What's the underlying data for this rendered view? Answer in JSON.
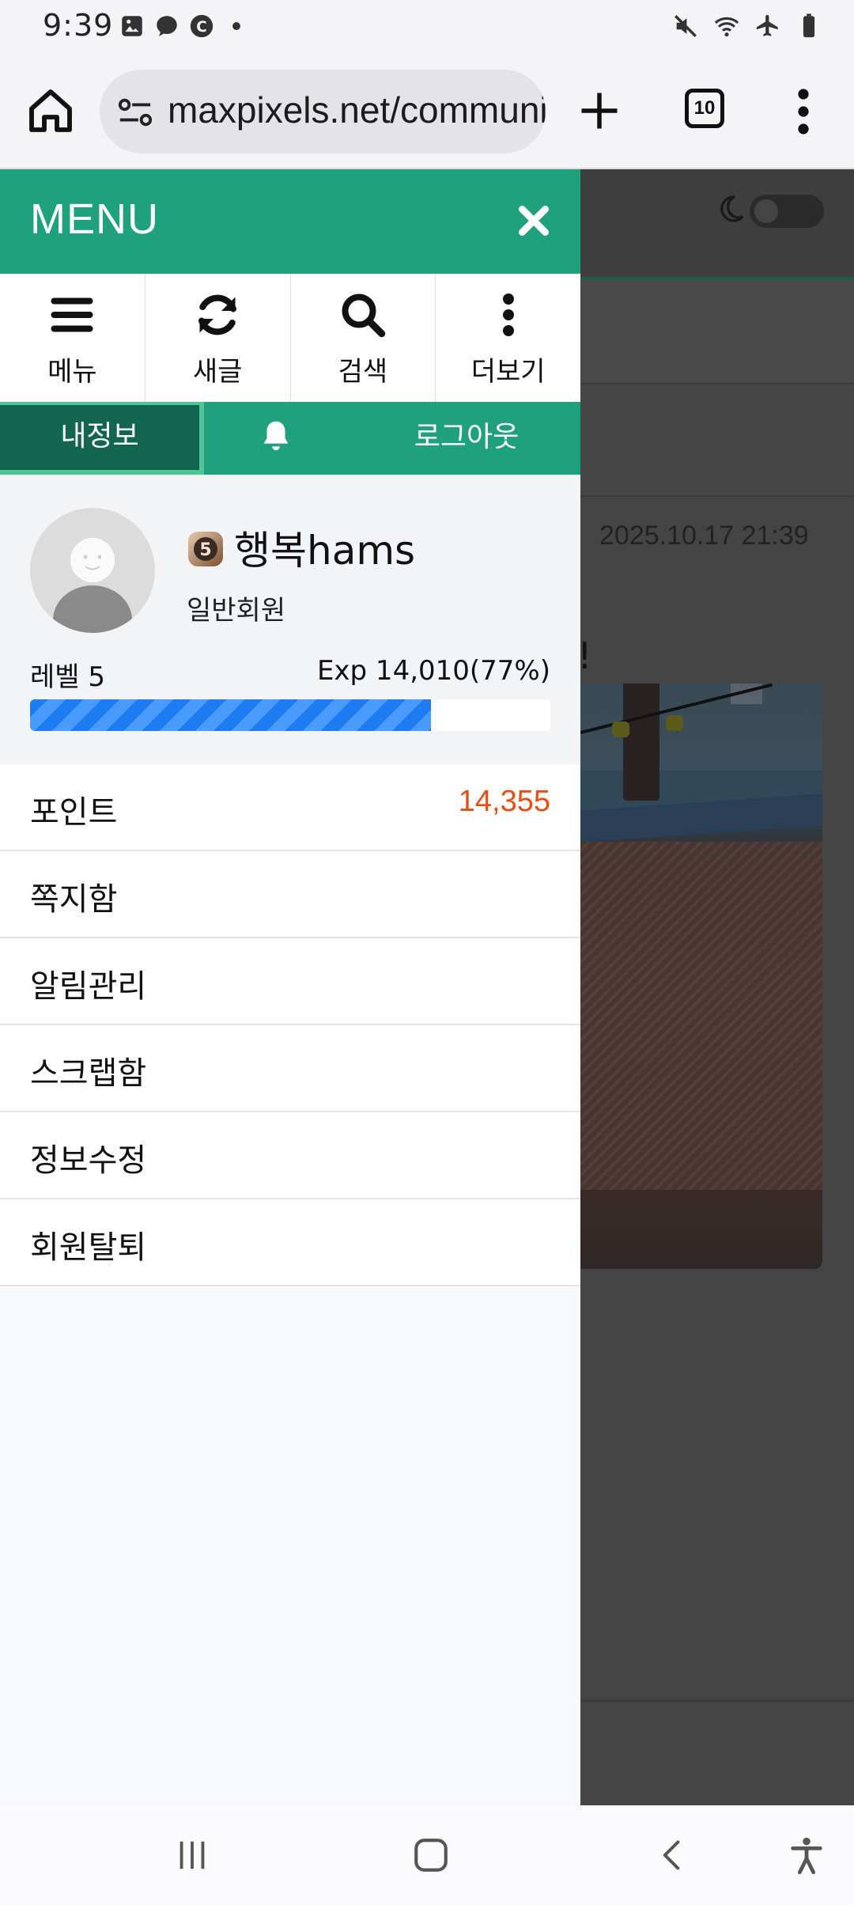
{
  "status_bar": {
    "time": "9:39",
    "left_icons": [
      "image-icon",
      "messenger-icon",
      "c-app-icon",
      "dot-icon"
    ],
    "right_icons": [
      "mute-icon",
      "wifi-icon",
      "airplane-icon",
      "battery-icon"
    ]
  },
  "browser": {
    "url": "maxpixels.net/community",
    "tab_count": "10"
  },
  "background_page": {
    "partial_char": "!",
    "date": "2025.10.17 21:39"
  },
  "drawer": {
    "title": "MENU",
    "quick_buttons": [
      {
        "label": "메뉴",
        "icon": "hamburger-icon"
      },
      {
        "label": "새글",
        "icon": "refresh-icon"
      },
      {
        "label": "검색",
        "icon": "search-icon"
      },
      {
        "label": "더보기",
        "icon": "more-vertical-icon"
      }
    ],
    "tabs": {
      "my_info": "내정보",
      "logout": "로그아웃"
    },
    "profile": {
      "level_badge": "5",
      "username": "행복hams",
      "role": "일반회원",
      "level_label": "레벨 5",
      "exp_label": "Exp 14,010(77%)",
      "exp_percent": 77
    },
    "menu_items": [
      {
        "label": "포인트",
        "value": "14,355"
      },
      {
        "label": "쪽지함"
      },
      {
        "label": "알림관리"
      },
      {
        "label": "스크랩함"
      },
      {
        "label": "정보수정"
      },
      {
        "label": "회원탈퇴"
      }
    ]
  },
  "colors": {
    "drawer_green": "#1fa17e",
    "active_tab": "#12664f",
    "points_orange": "#ea4d10",
    "exp_blue": "#1e7cf2"
  }
}
